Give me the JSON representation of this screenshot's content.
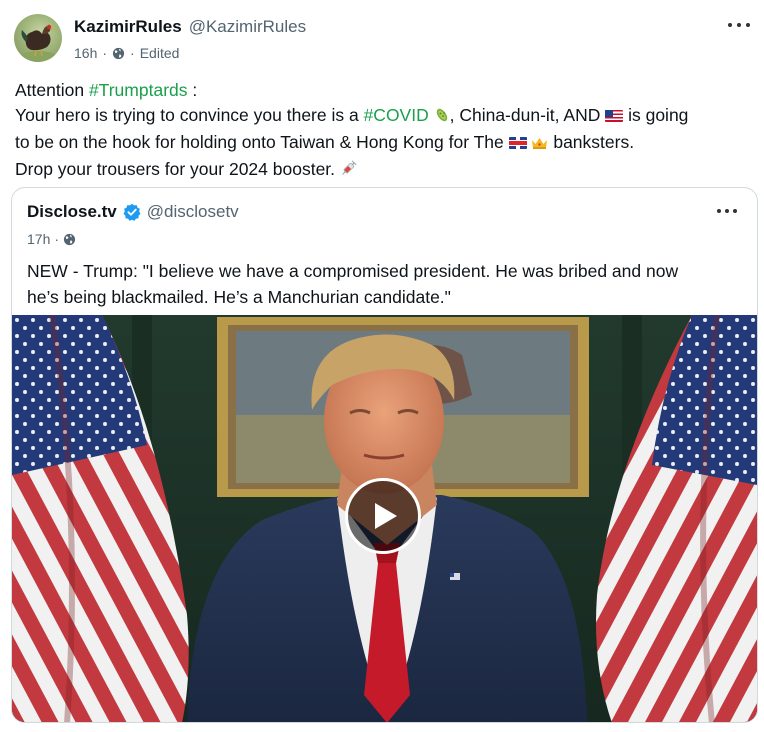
{
  "post": {
    "author": {
      "display_name": "KazimirRules",
      "handle": "@KazimirRules",
      "avatar_icon": "rooster-avatar"
    },
    "meta": {
      "time": "16h",
      "separator": "·",
      "visibility_icon": "globe-icon",
      "edited_label": "Edited"
    },
    "text": {
      "line1_prefix": "Attention ",
      "line1_hashtag": "#Trumptards",
      "line1_suffix": " :",
      "line2_prefix": "Your hero is trying to convince you there is a ",
      "line2_hashtag": "#COVID",
      "line2_emoji_1": "🦠",
      "line2_mid": ", China-dun-it, AND ",
      "line2_emoji_2": "🇺🇸",
      "line2_suffix": " is going",
      "line3_prefix": "to be on the hook for holding onto Taiwan & Hong Kong for The ",
      "line3_emoji_1": "🇬🇧",
      "line3_emoji_2": "👑",
      "line3_suffix": " banksters.",
      "line4_prefix": "Drop your trousers for your 2024 booster. ",
      "line4_emoji": "💉"
    },
    "more_icon": "more-dots-icon"
  },
  "quote": {
    "author": {
      "display_name": "Disclose.tv",
      "handle": "@disclosetv",
      "verified_icon": "verified-badge-icon"
    },
    "meta": {
      "time": "17h",
      "separator": "·",
      "visibility_icon": "globe-icon"
    },
    "text": {
      "line1": "NEW - Trump: \"I believe we have a compromised president. He was bribed and now",
      "line2": "he’s being blackmailed. He’s a Manchurian candidate.\""
    },
    "video": {
      "play_icon": "play-icon"
    }
  },
  "colors": {
    "hashtag": "#1aa04c",
    "secondary_text": "#536471",
    "border": "#cfd9de",
    "verified": "#1d9bf0"
  }
}
